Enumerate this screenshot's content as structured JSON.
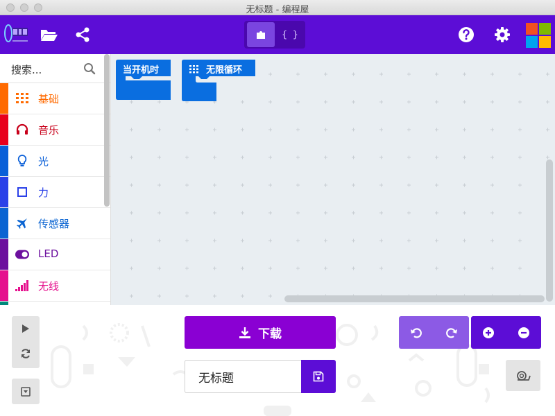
{
  "window": {
    "title": "无标题 - 编程屋"
  },
  "toolbar": {
    "brand_color": "#5c0dd6",
    "mode_blocks_icon": "puzzle-icon",
    "mode_js_label": "{ }"
  },
  "sidebar": {
    "search_placeholder": "搜索...",
    "categories": [
      {
        "label": "基础",
        "color": "#ff6a00",
        "text_color": "#ff6a00",
        "icon": "grid-icon"
      },
      {
        "label": "音乐",
        "color": "#e8001c",
        "text_color": "#c8001a",
        "icon": "headphones-icon"
      },
      {
        "label": "光",
        "color": "#0a5fd8",
        "text_color": "#0a5fd8",
        "icon": "lightbulb-icon"
      },
      {
        "label": "力",
        "color": "#2a40e8",
        "text_color": "#2a40e8",
        "icon": "square-icon"
      },
      {
        "label": "传感器",
        "color": "#0a64d2",
        "text_color": "#0a64d2",
        "icon": "airplane-icon"
      },
      {
        "label": "LED",
        "color": "#6c0f9e",
        "text_color": "#6c0f9e",
        "icon": "toggle-icon"
      },
      {
        "label": "无线",
        "color": "#e5108d",
        "text_color": "#e5108d",
        "icon": "signal-bars-icon"
      }
    ]
  },
  "workspace": {
    "blocks": [
      {
        "label": "当开机时",
        "color": "#0a6ee0"
      },
      {
        "label": "无限循环",
        "color": "#0a6ee0",
        "icon": "grid-icon"
      }
    ]
  },
  "bottom": {
    "download_label": "下载",
    "project_name": "无标题"
  }
}
